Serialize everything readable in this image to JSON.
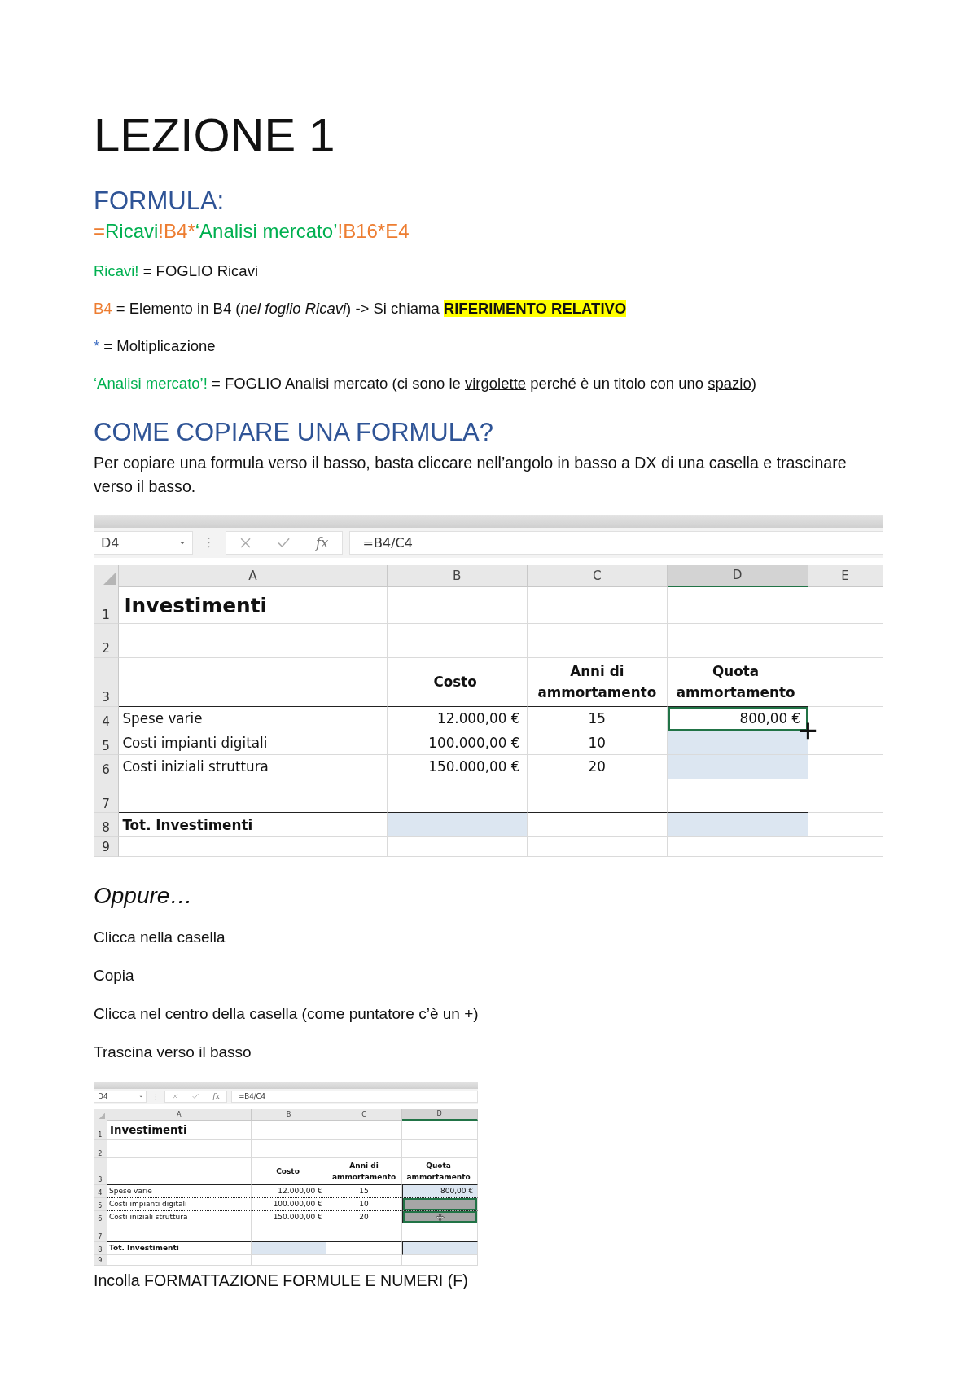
{
  "blocks": [
    {
      "kind": "title",
      "text": "LEZIONE 1"
    },
    {
      "kind": "heading",
      "text": "FORMULA:"
    },
    {
      "kind": "formula",
      "parts": [
        {
          "text": "=",
          "color": "#ed7d31"
        },
        {
          "text": "Ricavi",
          "color": "#00b050"
        },
        {
          "text": "!B4*",
          "color": "#ed7d31"
        },
        {
          "text": "‘Analisi mercato’",
          "color": "#00b050"
        },
        {
          "text": "!B16*E4",
          "color": "#ed7d31"
        }
      ]
    },
    {
      "kind": "definition",
      "parts": [
        {
          "kind": "term",
          "text": "Ricavi!",
          "color": "#00b050"
        },
        {
          "kind": "text",
          "text": " = FOGLIO Ricavi"
        }
      ]
    },
    {
      "kind": "definition",
      "parts": [
        {
          "kind": "term",
          "text": "B4",
          "color": "#ed7d31"
        },
        {
          "kind": "text",
          "text": " = Elemento in B4 ("
        },
        {
          "kind": "italic",
          "text": "nel foglio Ricavi"
        },
        {
          "kind": "text",
          "text": ") -> Si chiama "
        },
        {
          "kind": "highlight",
          "text": "RIFERIMENTO RELATIVO"
        }
      ]
    },
    {
      "kind": "definition",
      "parts": [
        {
          "kind": "term",
          "text": "*",
          "color": "#4472c4"
        },
        {
          "kind": "text",
          "text": " = Moltiplicazione"
        }
      ]
    },
    {
      "kind": "definition",
      "parts": [
        {
          "kind": "term",
          "text": "‘Analisi mercato’!",
          "color": "#00b050"
        },
        {
          "kind": "text",
          "text": " = FOGLIO Analisi mercato (ci sono le "
        },
        {
          "kind": "underline",
          "text": "virgolette"
        },
        {
          "kind": "text",
          "text": " perché è un titolo con uno "
        },
        {
          "kind": "underline",
          "text": "spazio"
        },
        {
          "kind": "text",
          "text": ")"
        }
      ]
    },
    {
      "kind": "heading",
      "text": "COME COPIARE UNA FORMULA?"
    },
    {
      "kind": "paragraph",
      "text": "Per copiare una formula verso il basso, basta cliccare nell’angolo in basso a DX di una casella e trascinare verso il basso."
    },
    {
      "kind": "spreadsheet",
      "zoomed_out": false,
      "name_box": "D4",
      "function_label": "fx",
      "formula": "=B4/C4",
      "columns": [
        {
          "label": "A",
          "selected": false
        },
        {
          "label": "B",
          "selected": false
        },
        {
          "label": "C",
          "selected": false
        },
        {
          "label": "D",
          "selected": true
        },
        {
          "label": "E",
          "selected": false
        }
      ],
      "rows": [
        {
          "header": "1",
          "kind": "title",
          "cells": [
            {
              "text": "Investimenti"
            },
            {},
            {},
            {},
            {}
          ]
        },
        {
          "header": "2",
          "kind": "blank",
          "cells": [
            {},
            {},
            {},
            {},
            {}
          ]
        },
        {
          "header": "3",
          "kind": "heading",
          "cells": [
            {},
            {
              "text": "Costo"
            },
            {
              "text": "Anni di ammortamento"
            },
            {
              "text": "Quota ammortamento"
            },
            {}
          ]
        },
        {
          "header": "4",
          "kind": "data",
          "marquee": true,
          "cells": [
            {
              "text": "Spese varie"
            },
            {
              "text": "12.000,00 €"
            },
            {
              "text": "15"
            },
            {
              "text": "800,00 €",
              "selected": true,
              "fill_handle_cursor": true
            },
            {}
          ]
        },
        {
          "header": "5",
          "kind": "data",
          "cells": [
            {
              "text": "Costi impianti digitali"
            },
            {
              "text": "100.000,00 €"
            },
            {
              "text": "10"
            },
            {
              "highlighted": true
            },
            {}
          ]
        },
        {
          "header": "6",
          "kind": "data",
          "cells": [
            {
              "text": "Costi iniziali struttura"
            },
            {
              "text": "150.000,00 €"
            },
            {
              "text": "20"
            },
            {
              "highlighted": true
            },
            {}
          ]
        },
        {
          "header": "7",
          "kind": "blank",
          "cells": [
            {},
            {},
            {},
            {},
            {}
          ]
        },
        {
          "header": "8",
          "kind": "total",
          "cells": [
            {
              "text": "Tot. Investimenti"
            },
            {
              "highlighted": true
            },
            {},
            {
              "highlighted": true
            },
            {}
          ]
        },
        {
          "header": "9",
          "kind": "blank",
          "cells": [
            {},
            {},
            {},
            {},
            {}
          ]
        }
      ]
    },
    {
      "kind": "subheading",
      "text": "Oppure…"
    },
    {
      "kind": "step",
      "text": "Clicca nella casella"
    },
    {
      "kind": "step",
      "text": "Copia"
    },
    {
      "kind": "step",
      "text": "Clicca nel centro della casella (come puntatore c’è un +)"
    },
    {
      "kind": "step",
      "text": "Trascina verso il basso"
    },
    {
      "kind": "spreadsheet",
      "zoomed_out": true,
      "name_box": "D4",
      "function_label": "fx",
      "formula": "=B4/C4",
      "columns": [
        {
          "label": "A",
          "selected": false
        },
        {
          "label": "B",
          "selected": false
        },
        {
          "label": "C",
          "selected": false
        },
        {
          "label": "D",
          "selected": true
        }
      ],
      "rows": [
        {
          "header": "1",
          "kind": "title",
          "cells": [
            {
              "text": "Investimenti"
            },
            {},
            {},
            {}
          ]
        },
        {
          "header": "2",
          "kind": "blank",
          "cells": [
            {},
            {},
            {},
            {}
          ]
        },
        {
          "header": "3",
          "kind": "heading",
          "cells": [
            {},
            {
              "text": "Costo"
            },
            {
              "text": "Anni di ammortamento"
            },
            {
              "text": "Quota ammortamento"
            }
          ]
        },
        {
          "header": "4",
          "kind": "data",
          "marquee": true,
          "cells": [
            {
              "text": "Spese varie"
            },
            {
              "text": "12.000,00 €"
            },
            {
              "text": "15"
            },
            {
              "text": "800,00 €",
              "highlighted": true
            }
          ]
        },
        {
          "header": "5",
          "kind": "data",
          "marquee": true,
          "cells": [
            {
              "text": "Costi impianti digitali"
            },
            {
              "text": "100.000,00 €"
            },
            {
              "text": "10"
            },
            {
              "dragging": true,
              "selected": true
            }
          ]
        },
        {
          "header": "6",
          "kind": "data",
          "cells": [
            {
              "text": "Costi iniziali struttura"
            },
            {
              "text": "150.000,00 €"
            },
            {
              "text": "20"
            },
            {
              "dragging": true,
              "selected": true,
              "move_cursor": true
            }
          ]
        },
        {
          "header": "7",
          "kind": "blank",
          "cells": [
            {},
            {},
            {},
            {}
          ]
        },
        {
          "header": "8",
          "kind": "total",
          "cells": [
            {
              "text": "Tot. Investimenti"
            },
            {
              "highlighted": true
            },
            {},
            {
              "highlighted": true
            }
          ]
        },
        {
          "header": "9",
          "kind": "blank",
          "cells": [
            {},
            {},
            {},
            {}
          ]
        }
      ]
    },
    {
      "kind": "paragraph",
      "text": "Incolla FORMATTAZIONE FORMULE E NUMERI (F)"
    }
  ]
}
